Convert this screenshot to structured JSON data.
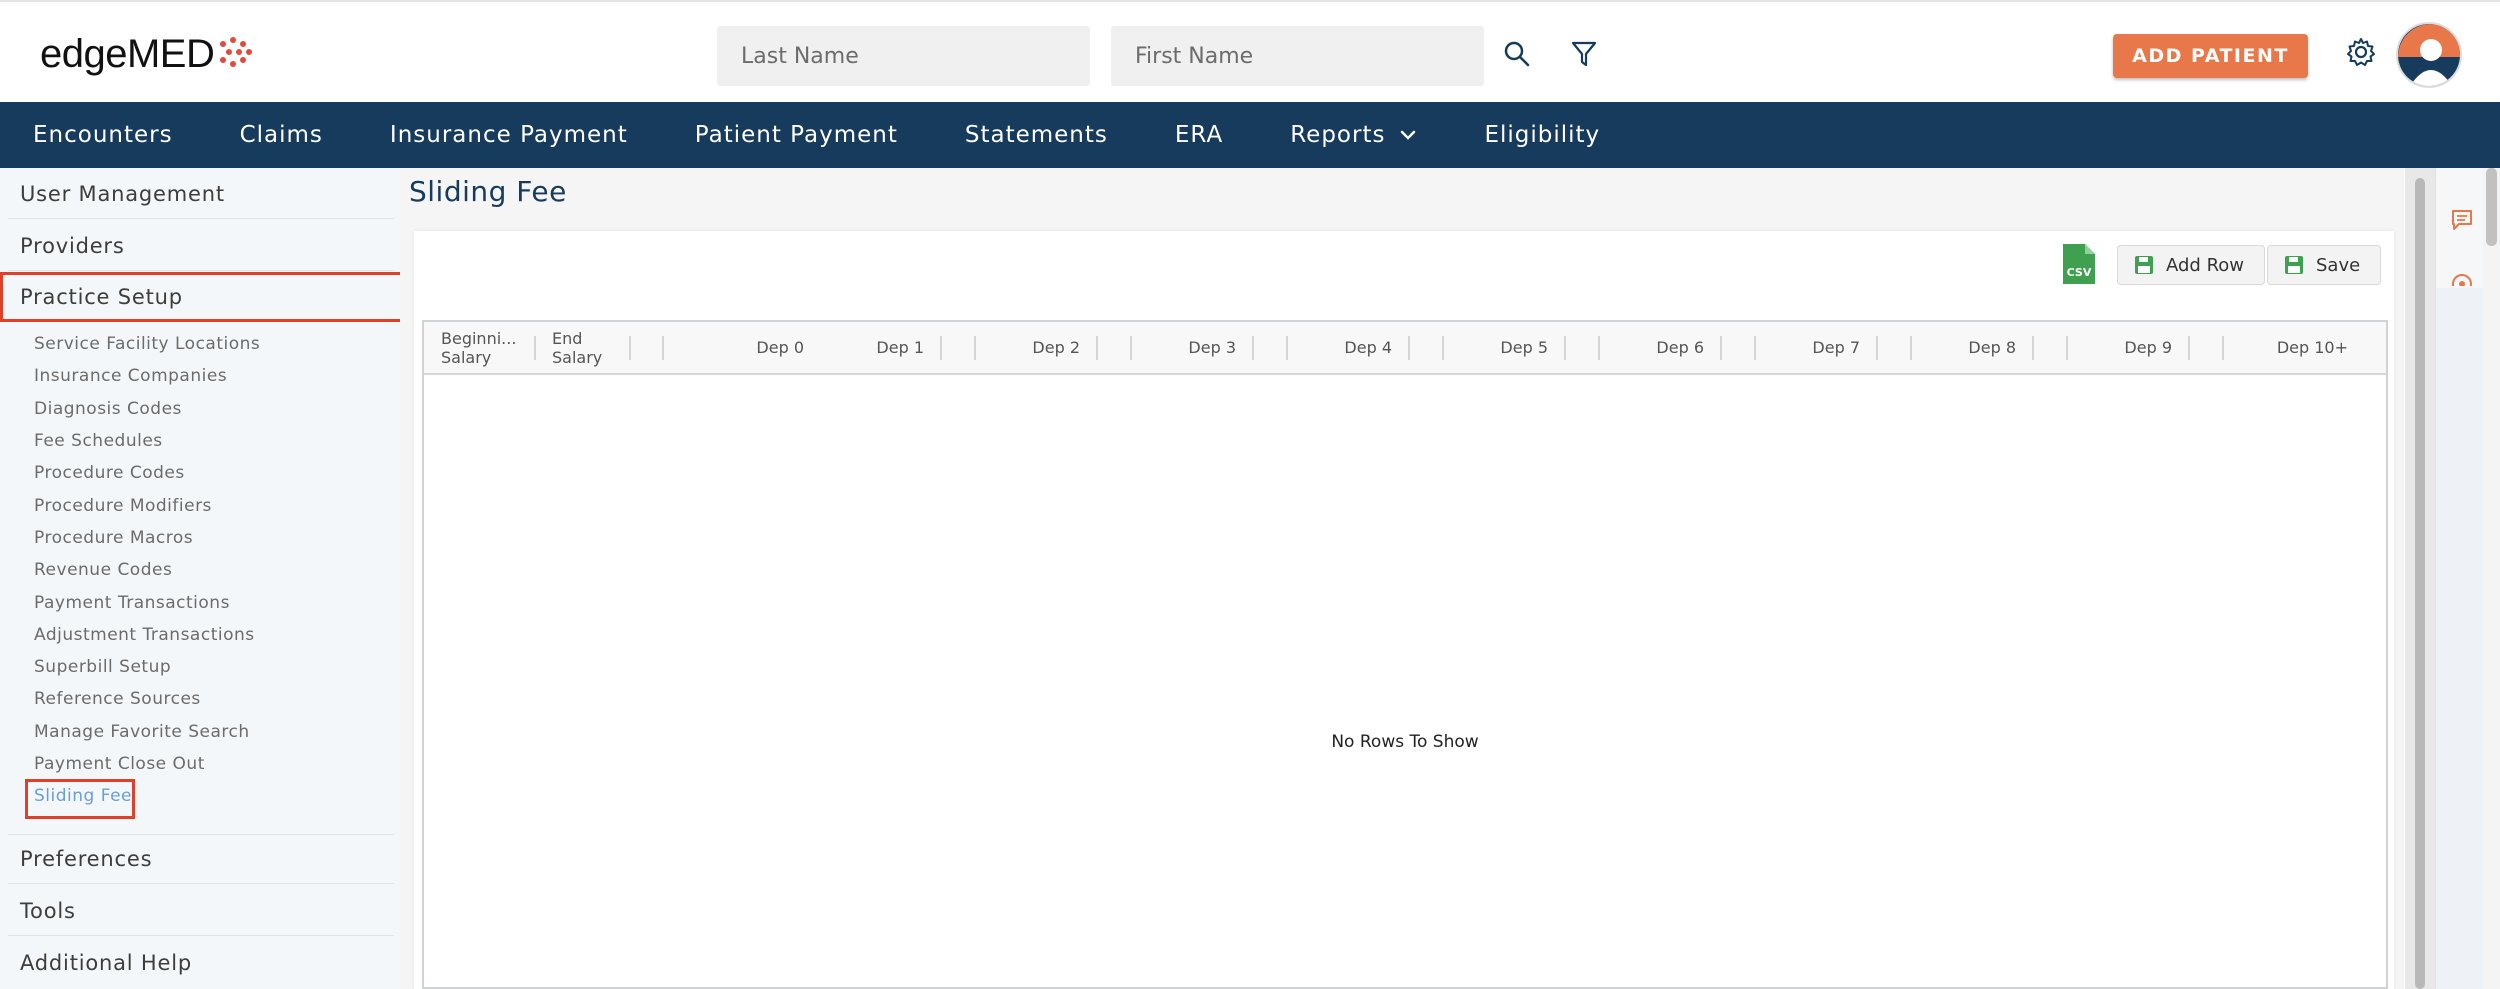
{
  "app": {
    "logo_text": "edgeMED"
  },
  "header": {
    "last_name_placeholder": "Last Name",
    "first_name_placeholder": "First Name",
    "add_patient_label": "ADD PATIENT"
  },
  "nav": {
    "items": [
      {
        "label": "Encounters"
      },
      {
        "label": "Claims"
      },
      {
        "label": "Insurance Payment"
      },
      {
        "label": "Patient Payment"
      },
      {
        "label": "Statements"
      },
      {
        "label": "ERA"
      },
      {
        "label": "Reports"
      },
      {
        "label": "Eligibility"
      }
    ]
  },
  "sidebar": {
    "sections": [
      {
        "label": "User Management"
      },
      {
        "label": "Providers"
      },
      {
        "label": "Practice Setup"
      },
      {
        "label": "Preferences"
      },
      {
        "label": "Tools"
      },
      {
        "label": "Additional Help"
      }
    ],
    "practice_setup_items": [
      {
        "label": "Service Facility Locations"
      },
      {
        "label": "Insurance Companies"
      },
      {
        "label": "Diagnosis Codes"
      },
      {
        "label": "Fee Schedules"
      },
      {
        "label": "Procedure Codes"
      },
      {
        "label": "Procedure Modifiers"
      },
      {
        "label": "Procedure Macros"
      },
      {
        "label": "Revenue Codes"
      },
      {
        "label": "Payment Transactions"
      },
      {
        "label": "Adjustment Transactions"
      },
      {
        "label": "Superbill Setup"
      },
      {
        "label": "Reference Sources"
      },
      {
        "label": "Manage Favorite Search"
      },
      {
        "label": "Payment Close Out"
      },
      {
        "label": "Sliding Fee"
      }
    ],
    "active_item": "Sliding Fee"
  },
  "page": {
    "title": "Sliding Fee",
    "csv_label": "CSV",
    "add_row_label": "Add Row",
    "save_label": "Save",
    "empty_message": "No Rows To Show"
  },
  "grid": {
    "columns": [
      {
        "line1": "Beginni...",
        "line2": "Salary"
      },
      {
        "line1": "End",
        "line2": "Salary"
      },
      {
        "line1": "Dep 0"
      },
      {
        "line1": "Dep 1"
      },
      {
        "line1": "Dep 2"
      },
      {
        "line1": "Dep 3"
      },
      {
        "line1": "Dep 4"
      },
      {
        "line1": "Dep 5"
      },
      {
        "line1": "Dep 6"
      },
      {
        "line1": "Dep 7"
      },
      {
        "line1": "Dep 8"
      },
      {
        "line1": "Dep 9"
      },
      {
        "line1": "Dep 10+"
      }
    ]
  },
  "colors": {
    "nav_bg": "#173b5c",
    "accent": "#e8784a",
    "highlight": "#e0402a",
    "active_link": "#6a9fd4",
    "csv_green": "#3fa14f"
  },
  "icons": {
    "search": "search-icon",
    "filter": "filter-icon",
    "settings": "gear-icon",
    "avatar": "user-avatar",
    "csv": "csv-file-icon",
    "add_row": "floppy-icon",
    "save": "floppy-icon",
    "chat": "chat-icon",
    "help": "help-icon"
  }
}
